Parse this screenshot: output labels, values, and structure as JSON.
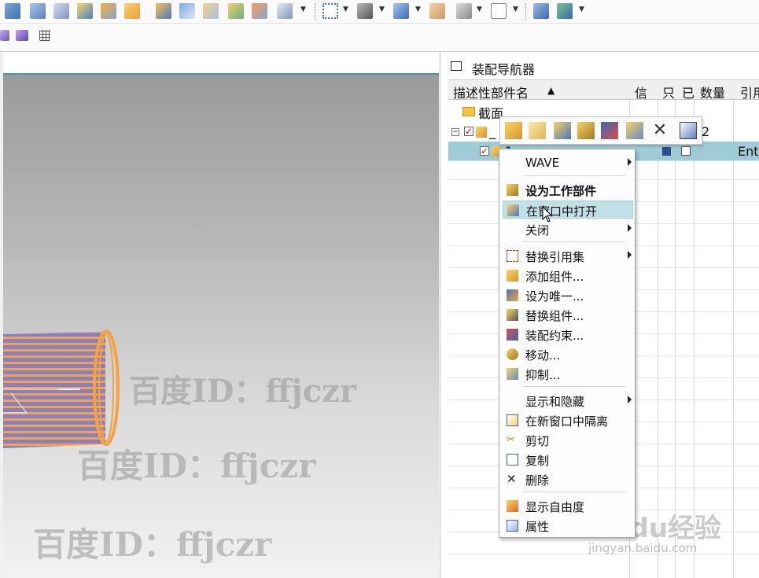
{
  "navigator": {
    "title": "装配导航器",
    "columns": [
      "描述性部件名",
      "信",
      "只",
      "已",
      "数量",
      "引用"
    ],
    "sort_indicator": "▲",
    "tree": [
      {
        "label": "截面"
      },
      {
        "label": "_",
        "count": "2"
      },
      {
        "label": "1",
        "ref": "Ent"
      }
    ]
  },
  "context_menu": {
    "items": [
      {
        "label": "WAVE",
        "submenu": true
      },
      {
        "label": "设为工作部件",
        "bold": true
      },
      {
        "label": "在窗口中打开",
        "highlighted": true
      },
      {
        "label": "关闭",
        "submenu": true
      },
      {
        "label": "替换引用集",
        "submenu": true
      },
      {
        "label": "添加组件..."
      },
      {
        "label": "设为唯一..."
      },
      {
        "label": "替换组件..."
      },
      {
        "label": "装配约束..."
      },
      {
        "label": "移动..."
      },
      {
        "label": "抑制..."
      },
      {
        "label": "显示和隐藏",
        "submenu": true
      },
      {
        "label": "在新窗口中隔离"
      },
      {
        "label": "剪切"
      },
      {
        "label": "复制"
      },
      {
        "label": "删除"
      },
      {
        "label": "显示自由度"
      },
      {
        "label": "属性"
      }
    ]
  },
  "watermarks": [
    "百度ID：ffjczr",
    "百度ID：ffjczr",
    "百度ID：ffjczr"
  ],
  "baidu_logo": "Baidu经验",
  "baidu_url": "jingyan.baidu.com",
  "colors": {
    "accent": "#4a97b2",
    "selection": "#9ecbd6",
    "menu_highlight": "#c1dfe6",
    "cylinder_stripe": "#f3a247",
    "cylinder_body": "#8a7fc0"
  }
}
